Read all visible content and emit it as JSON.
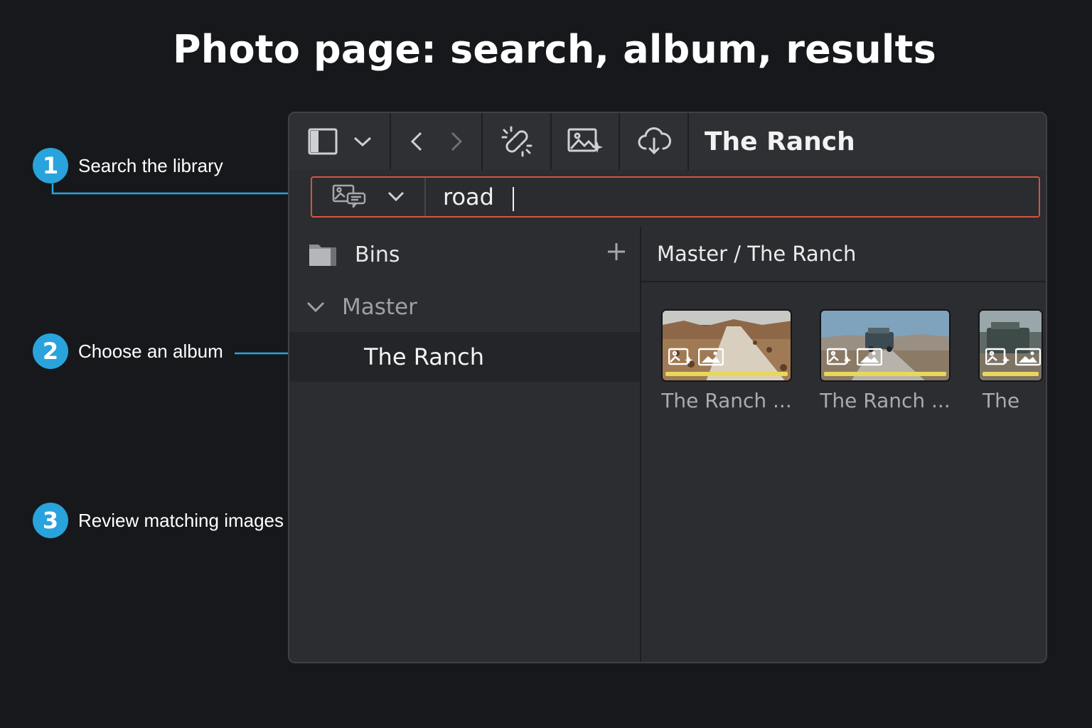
{
  "page": {
    "title": "Photo page: search, album, results"
  },
  "callouts": [
    {
      "number": "1",
      "text": "Search the library"
    },
    {
      "number": "2",
      "text": "Choose an album"
    },
    {
      "number": "3",
      "text": "Review matching images"
    }
  ],
  "toolbar": {
    "title": "The Ranch",
    "icons": [
      "sidebar-toggle-icon",
      "chevron-down-icon",
      "back-arrow-icon",
      "forward-arrow-icon",
      "unlink-icon",
      "image-sparkle-icon",
      "cloud-download-icon"
    ]
  },
  "search": {
    "value": "road",
    "mode_icon": "caption-search-icon"
  },
  "sidebar": {
    "header": "Bins",
    "items": [
      {
        "label": "Master",
        "expanded": true
      },
      {
        "label": "The Ranch",
        "selected": true
      }
    ]
  },
  "content": {
    "breadcrumb": "Master / The Ranch",
    "thumbnails": [
      {
        "label": "The Ranch ..."
      },
      {
        "label": "The Ranch ..."
      },
      {
        "label": "The"
      }
    ]
  },
  "colors": {
    "accent": "#29a3dc",
    "search_border": "#d4553f",
    "thumb_bar": "#e8d85a"
  }
}
